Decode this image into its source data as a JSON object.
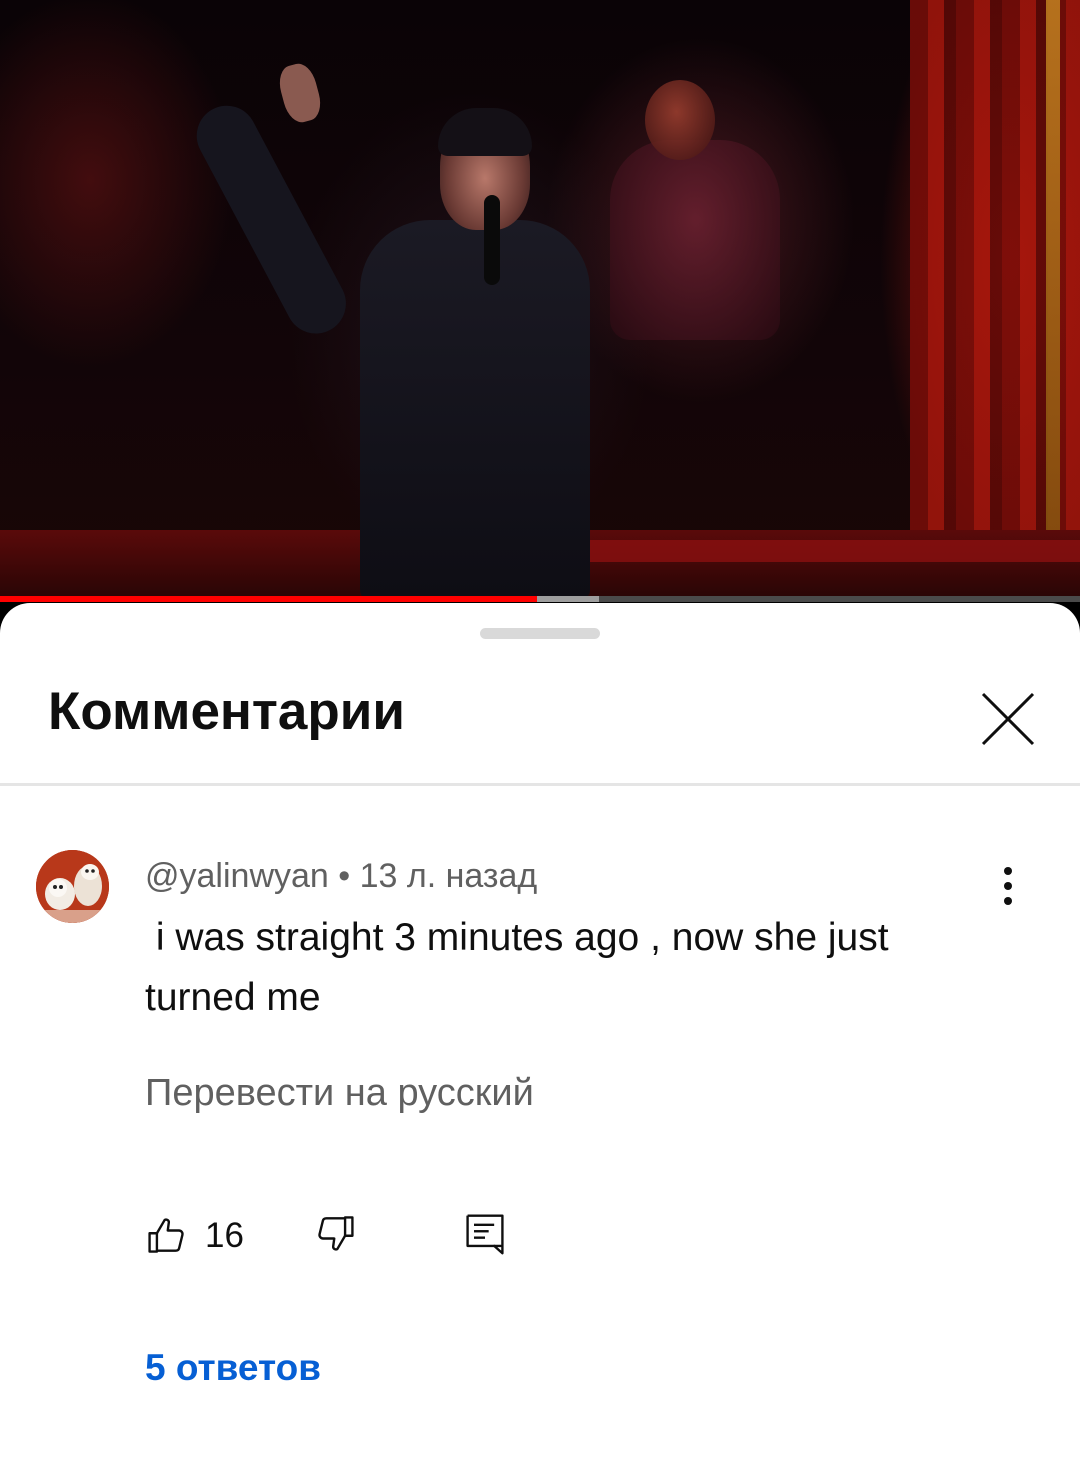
{
  "video": {
    "progress_played": 0.497,
    "progress_buffered": 0.555,
    "colors": {
      "played": "#ff0000",
      "buffered": "#9e9e9e",
      "track": "#4a4a4a"
    }
  },
  "comments_sheet": {
    "title": "Комментарии",
    "close_icon": "close-icon"
  },
  "comment": {
    "author": "@yalinwyan",
    "separator": "•",
    "time": "13 л. назад",
    "text": " i was straight 3 minutes ago , now she just turned me",
    "translate_label": "Перевести на русский",
    "likes": "16",
    "more_icon": "more-vert-icon",
    "like_icon": "thumbs-up-icon",
    "dislike_icon": "thumbs-down-icon",
    "reply_icon": "reply-icon",
    "replies_label": "5 ответов",
    "colors": {
      "link": "#065fd4",
      "meta": "#606060",
      "text": "#0f0f0f"
    }
  }
}
